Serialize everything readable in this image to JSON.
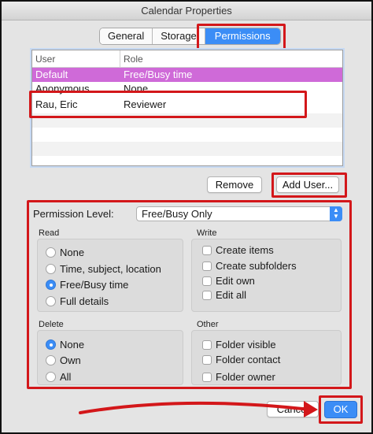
{
  "window": {
    "title": "Calendar Properties"
  },
  "tabs": [
    {
      "label": "General"
    },
    {
      "label": "Storage"
    },
    {
      "label": "Permissions"
    }
  ],
  "users_table": {
    "columns": [
      "User",
      "Role"
    ],
    "rows": [
      {
        "user": "Default",
        "role": "Free/Busy time"
      },
      {
        "user": "Anonymous",
        "role": "None"
      },
      {
        "user": "Rau, Eric",
        "role": "Reviewer"
      }
    ]
  },
  "buttons": {
    "remove": "Remove",
    "add_user": "Add User...",
    "cancel": "Cancel",
    "ok": "OK"
  },
  "permission_level": {
    "label": "Permission Level:",
    "value": "Free/Busy Only"
  },
  "read": {
    "title": "Read",
    "options": [
      "None",
      "Time, subject, location",
      "Free/Busy time",
      "Full details"
    ],
    "selected": "Free/Busy time"
  },
  "write": {
    "title": "Write",
    "options": [
      "Create items",
      "Create subfolders",
      "Edit own",
      "Edit all"
    ]
  },
  "delete": {
    "title": "Delete",
    "options": [
      "None",
      "Own",
      "All"
    ],
    "selected": "None"
  },
  "other": {
    "title": "Other",
    "options": [
      "Folder visible",
      "Folder contact",
      "Folder owner"
    ]
  },
  "colors": {
    "accent": "#3b8df6",
    "selection": "#cf6ad8",
    "annotation_red": "#d3171a"
  }
}
